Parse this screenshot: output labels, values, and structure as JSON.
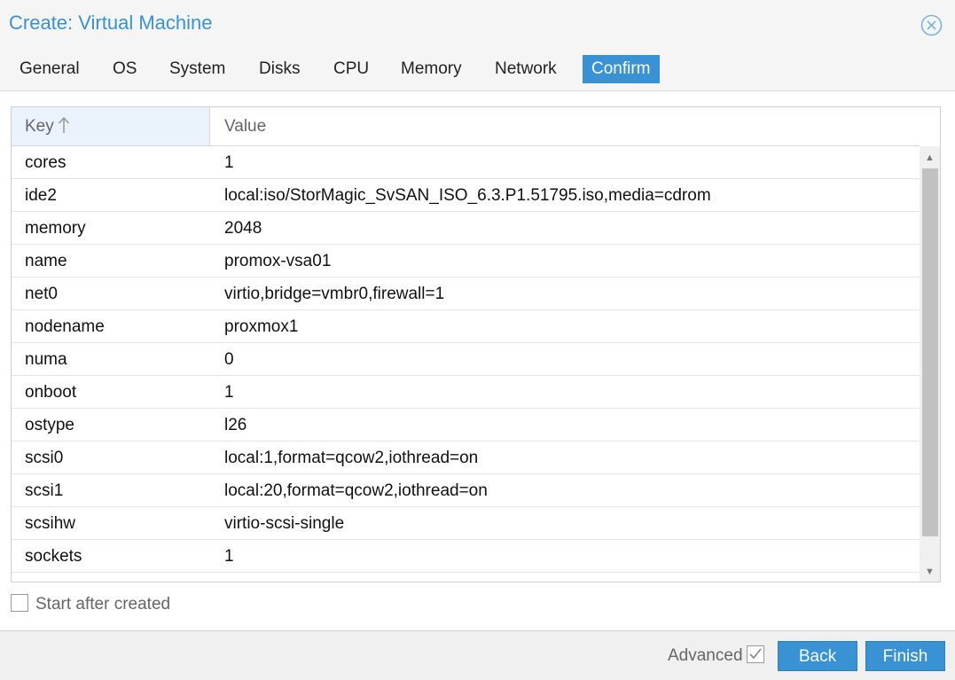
{
  "window": {
    "title": "Create: Virtual Machine",
    "close_icon": "close-circle-icon"
  },
  "tabs": [
    {
      "label": "General",
      "active": false
    },
    {
      "label": "OS",
      "active": false
    },
    {
      "label": "System",
      "active": false
    },
    {
      "label": "Disks",
      "active": false
    },
    {
      "label": "CPU",
      "active": false
    },
    {
      "label": "Memory",
      "active": false
    },
    {
      "label": "Network",
      "active": false
    },
    {
      "label": "Confirm",
      "active": true
    }
  ],
  "grid": {
    "columns": {
      "key": "Key",
      "value": "Value"
    },
    "sort_icon": "sort-arrow-up-icon",
    "rows": [
      {
        "key": "cores",
        "value": "1"
      },
      {
        "key": "ide2",
        "value": "local:iso/StorMagic_SvSAN_ISO_6.3.P1.51795.iso,media=cdrom"
      },
      {
        "key": "memory",
        "value": "2048"
      },
      {
        "key": "name",
        "value": "promox-vsa01"
      },
      {
        "key": "net0",
        "value": "virtio,bridge=vmbr0,firewall=1"
      },
      {
        "key": "nodename",
        "value": "proxmox1"
      },
      {
        "key": "numa",
        "value": "0"
      },
      {
        "key": "onboot",
        "value": "1"
      },
      {
        "key": "ostype",
        "value": "l26"
      },
      {
        "key": "scsi0",
        "value": "local:1,format=qcow2,iothread=on"
      },
      {
        "key": "scsi1",
        "value": "local:20,format=qcow2,iothread=on"
      },
      {
        "key": "scsihw",
        "value": "virtio-scsi-single"
      },
      {
        "key": "sockets",
        "value": "1"
      }
    ]
  },
  "start_after_created": {
    "label": "Start after created",
    "checked": false
  },
  "footer": {
    "advanced_label": "Advanced",
    "advanced_checked": true,
    "back_label": "Back",
    "finish_label": "Finish"
  },
  "colors": {
    "accent": "#3892d4",
    "title": "#3892d4"
  }
}
